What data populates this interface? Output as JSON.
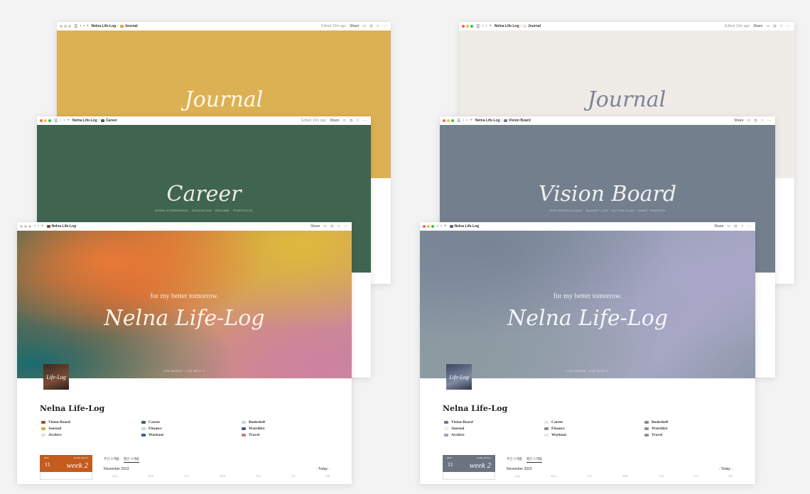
{
  "left": {
    "back_window": {
      "breadcrumb": [
        "Nelna Life-Log",
        "Journal"
      ],
      "edited": "Edited 13m ago",
      "share": "Share",
      "title": "Journal",
      "cover_color": "#dcb153"
    },
    "mid_window": {
      "breadcrumb": [
        "Nelna Life-Log",
        "Career"
      ],
      "edited": "Edited 16m ago",
      "share": "Share",
      "title": "Career",
      "subtitle": "WORK EXPERIENCE · EDUCATION · RESUME · PORTFOLIO",
      "cover_color": "#3f6550"
    },
    "front_window": {
      "breadcrumb": [
        "Nelna Life-Log"
      ],
      "share": "Share",
      "tagline": "for my better tomorrow.",
      "title": "Nelna Life-Log",
      "small_caption": "LIFE-WORKS · LIVE WITH IT",
      "avatar_text": "Life-Log",
      "page_title": "Nelna Life-Log",
      "links": [
        {
          "label": "Vision Board",
          "color": "#a0522d"
        },
        {
          "label": "Career",
          "color": "#3f6550"
        },
        {
          "label": "Bookshelf",
          "color": "#d9d3c9"
        },
        {
          "label": "Journal",
          "color": "#d6a844"
        },
        {
          "label": "Finance",
          "color": "#d9d3c9"
        },
        {
          "label": "Watchlist",
          "color": "#4a5a7a"
        },
        {
          "label": "Archive",
          "color": "#e8e1d4"
        },
        {
          "label": "Workout",
          "color": "#3b5b9a"
        },
        {
          "label": "Travel",
          "color": "#c97c7c"
        }
      ],
      "week_card": {
        "year": "2023",
        "small": "weekly planner",
        "day": "11",
        "week": "week 2",
        "color": "#c45c1e"
      },
      "tabs": [
        "주간 스케줄",
        "월간 스케줄"
      ],
      "calendar": {
        "month": "November 2023",
        "today": "Today",
        "days": [
          "Sun",
          "Mon",
          "Tue",
          "Wed",
          "Thu",
          "Fri",
          "Sat"
        ]
      }
    }
  },
  "right": {
    "back_window": {
      "breadcrumb": [
        "Nelna Life-Log",
        "Journal"
      ],
      "edited": "Edited 13m ago",
      "share": "Share",
      "title": "Journal",
      "cover_color": "#efebe7"
    },
    "mid_window": {
      "breadcrumb": [
        "Nelna Life-Log",
        "Vision Board"
      ],
      "share": "Share",
      "title": "Vision Board",
      "subtitle": "2023 RESOLUTIONS · BUCKET LIST · ACTION PLAN · HABIT TRACKER",
      "cover_color": "#747f8e"
    },
    "front_window": {
      "breadcrumb": [
        "Nelna Life-Log"
      ],
      "share": "Share",
      "tagline": "for my better tomorrow.",
      "title": "Nelna Life-Log",
      "small_caption": "LIFE-WORKS · LIVE WITH IT",
      "avatar_text": "Life-Log",
      "page_title": "Nelna Life-Log",
      "links": [
        {
          "label": "Vision Board",
          "color": "#6e7a8a"
        },
        {
          "label": "Career",
          "color": "#e6e6e6"
        },
        {
          "label": "Bookshelf",
          "color": "#8a8a8a"
        },
        {
          "label": "Journal",
          "color": "#f0ede6"
        },
        {
          "label": "Finance",
          "color": "#8f8f8f"
        },
        {
          "label": "Watchlist",
          "color": "#8f8f8f"
        },
        {
          "label": "Archive",
          "color": "#9aa3b8"
        },
        {
          "label": "Workout",
          "color": "#e6e6e6"
        },
        {
          "label": "Travel",
          "color": "#8f8f8f"
        }
      ],
      "week_card": {
        "year": "2023",
        "small": "weekly planner",
        "day": "11",
        "week": "week 2",
        "color": "#6b7480"
      },
      "tabs": [
        "주간 스케줄",
        "월간 스케줄"
      ],
      "calendar": {
        "month": "November 2023",
        "today": "Today",
        "days": [
          "Sun",
          "Mon",
          "Tue",
          "Wed",
          "Thu",
          "Fri",
          "Sat"
        ]
      }
    }
  }
}
